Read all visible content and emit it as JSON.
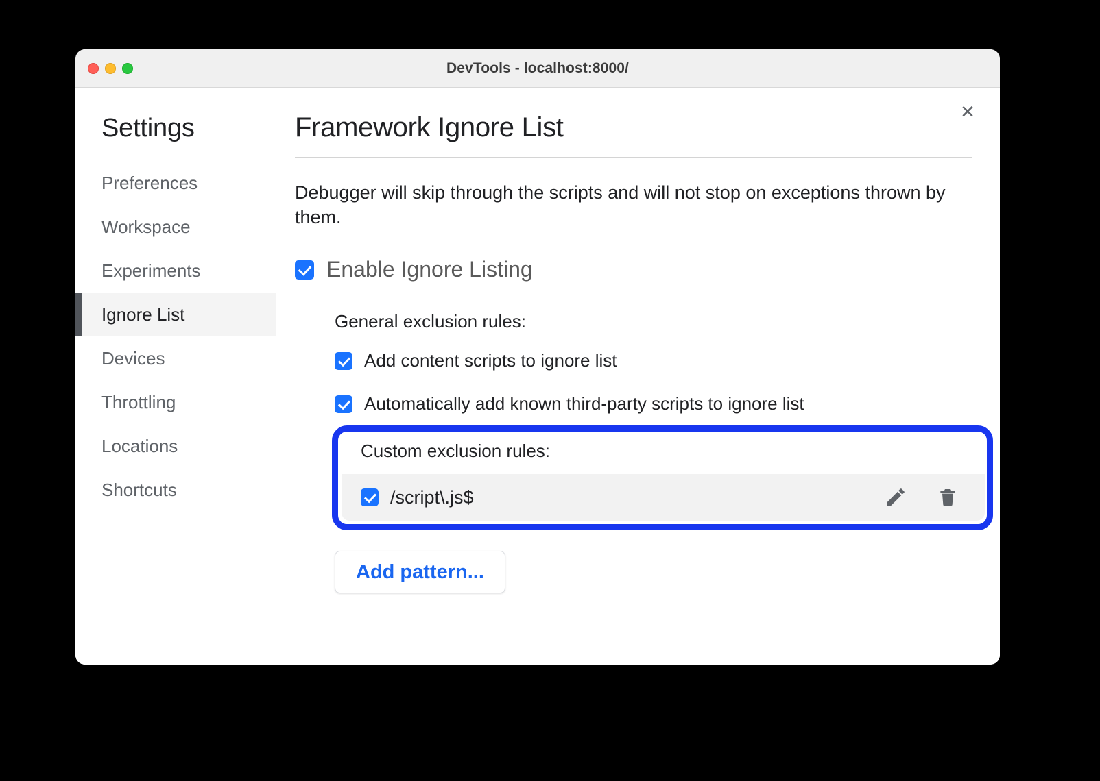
{
  "window": {
    "title": "DevTools - localhost:8000/",
    "traffic_lights": [
      {
        "name": "close",
        "color": "#FF5F57"
      },
      {
        "name": "minimize",
        "color": "#FEBC2E"
      },
      {
        "name": "maximize",
        "color": "#28C840"
      }
    ],
    "close_icon": "✕"
  },
  "sidebar": {
    "title": "Settings",
    "items": [
      {
        "label": "Preferences",
        "selected": false
      },
      {
        "label": "Workspace",
        "selected": false
      },
      {
        "label": "Experiments",
        "selected": false
      },
      {
        "label": "Ignore List",
        "selected": true
      },
      {
        "label": "Devices",
        "selected": false
      },
      {
        "label": "Throttling",
        "selected": false
      },
      {
        "label": "Locations",
        "selected": false
      },
      {
        "label": "Shortcuts",
        "selected": false
      }
    ]
  },
  "main": {
    "page_title": "Framework Ignore List",
    "description": "Debugger will skip through the scripts and will not stop on exceptions thrown by them.",
    "enable_ignore_listing": {
      "label": "Enable Ignore Listing",
      "checked": true
    },
    "general_rules": {
      "heading": "General exclusion rules:",
      "items": [
        {
          "label": "Add content scripts to ignore list",
          "checked": true
        },
        {
          "label": "Automatically add known third-party scripts to ignore list",
          "checked": true
        }
      ]
    },
    "custom_rules": {
      "heading": "Custom exclusion rules:",
      "highlighted": true,
      "highlight_color": "#1836EF",
      "patterns": [
        {
          "value": "/script\\.js$",
          "checked": true,
          "edit_icon": "pencil-icon",
          "delete_icon": "trash-icon"
        }
      ]
    },
    "add_pattern_label": "Add pattern...",
    "accent_color": "#1A73FF",
    "link_color": "#1A66F0"
  }
}
